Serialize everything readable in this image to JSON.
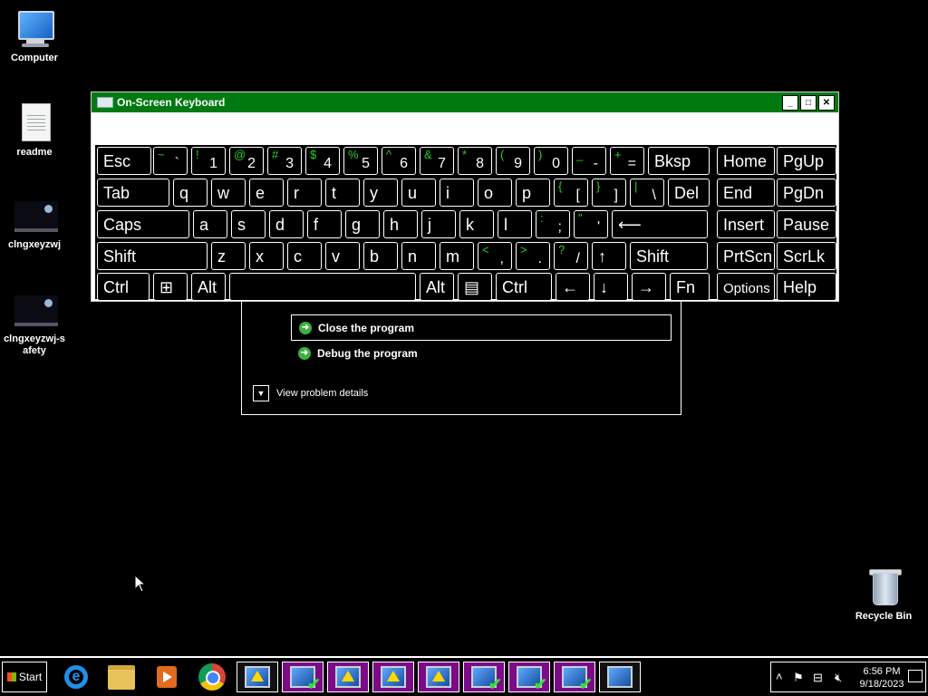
{
  "desktop": {
    "icons": [
      {
        "label": "Computer",
        "icon": "computer-icon"
      },
      {
        "label": "readme",
        "icon": "text-document-icon"
      },
      {
        "label": "clngxeyzwj",
        "icon": "image-file-icon"
      },
      {
        "label": "clngxeyzwj-s\nafety",
        "icon": "image-file-icon"
      },
      {
        "label": "Recycle Bin",
        "icon": "recycle-bin-icon"
      }
    ]
  },
  "error_dialog": {
    "close_label": "Close the program",
    "debug_label": "Debug the program",
    "details_label": "View problem details"
  },
  "osk": {
    "title": "On-Screen Keyboard",
    "rows": [
      [
        {
          "label": "Esc"
        },
        {
          "shift": "~",
          "base": "`"
        },
        {
          "shift": "!",
          "base": "1"
        },
        {
          "shift": "@",
          "base": "2"
        },
        {
          "shift": "#",
          "base": "3"
        },
        {
          "shift": "$",
          "base": "4"
        },
        {
          "shift": "%",
          "base": "5"
        },
        {
          "shift": "^",
          "base": "6"
        },
        {
          "shift": "&",
          "base": "7"
        },
        {
          "shift": "*",
          "base": "8"
        },
        {
          "shift": "(",
          "base": "9"
        },
        {
          "shift": ")",
          "base": "0"
        },
        {
          "shift": "_",
          "base": "-"
        },
        {
          "shift": "+",
          "base": "="
        },
        {
          "label": "Bksp"
        },
        {
          "label": "Home"
        },
        {
          "label": "PgUp"
        }
      ],
      [
        {
          "label": "Tab"
        },
        {
          "label": "q"
        },
        {
          "label": "w"
        },
        {
          "label": "e"
        },
        {
          "label": "r"
        },
        {
          "label": "t"
        },
        {
          "label": "y"
        },
        {
          "label": "u"
        },
        {
          "label": "i"
        },
        {
          "label": "o"
        },
        {
          "label": "p"
        },
        {
          "shift": "{",
          "base": "["
        },
        {
          "shift": "}",
          "base": "]"
        },
        {
          "shift": "|",
          "base": "\\"
        },
        {
          "label": "Del"
        },
        {
          "label": "End"
        },
        {
          "label": "PgDn"
        }
      ],
      [
        {
          "label": "Caps"
        },
        {
          "label": "a"
        },
        {
          "label": "s"
        },
        {
          "label": "d"
        },
        {
          "label": "f"
        },
        {
          "label": "g"
        },
        {
          "label": "h"
        },
        {
          "label": "j"
        },
        {
          "label": "k"
        },
        {
          "label": "l"
        },
        {
          "shift": ":",
          "base": ";"
        },
        {
          "shift": "\"",
          "base": "'"
        },
        {
          "label": "⟵"
        },
        {
          "label": "Insert"
        },
        {
          "label": "Pause"
        }
      ],
      [
        {
          "label": "Shift"
        },
        {
          "label": "z"
        },
        {
          "label": "x"
        },
        {
          "label": "c"
        },
        {
          "label": "v"
        },
        {
          "label": "b"
        },
        {
          "label": "n"
        },
        {
          "label": "m"
        },
        {
          "shift": "<",
          "base": ","
        },
        {
          "shift": ">",
          "base": "."
        },
        {
          "shift": "?",
          "base": "/"
        },
        {
          "label": "↑"
        },
        {
          "label": "Shift"
        },
        {
          "label": "PrtScn"
        },
        {
          "label": "ScrLk"
        }
      ],
      [
        {
          "label": "Ctrl"
        },
        {
          "label": "⊞"
        },
        {
          "label": "Alt"
        },
        {
          "label": ""
        },
        {
          "label": "Alt"
        },
        {
          "label": "▤"
        },
        {
          "label": "Ctrl"
        },
        {
          "label": "←"
        },
        {
          "label": "↓"
        },
        {
          "label": "→"
        },
        {
          "label": "Fn"
        },
        {
          "label": "Options"
        },
        {
          "label": "Help"
        }
      ]
    ]
  },
  "taskbar": {
    "start_label": "Start",
    "pinned": [
      "internet-explorer-icon",
      "file-explorer-icon",
      "media-player-icon",
      "chrome-icon"
    ],
    "tasks": [
      {
        "icon": "program-warning-icon",
        "style": "dark"
      },
      {
        "icon": "program-check-icon",
        "style": "purple"
      },
      {
        "icon": "program-warning-icon",
        "style": "purple"
      },
      {
        "icon": "program-warning-icon",
        "style": "purple"
      },
      {
        "icon": "program-warning-icon",
        "style": "purple"
      },
      {
        "icon": "program-check-icon",
        "style": "purple"
      },
      {
        "icon": "program-check-icon",
        "style": "purple"
      },
      {
        "icon": "program-check-icon",
        "style": "purple"
      },
      {
        "icon": "on-screen-keyboard-icon",
        "style": "dark"
      }
    ],
    "tray": {
      "time": "6:56 PM",
      "date": "9/18/2023"
    }
  }
}
